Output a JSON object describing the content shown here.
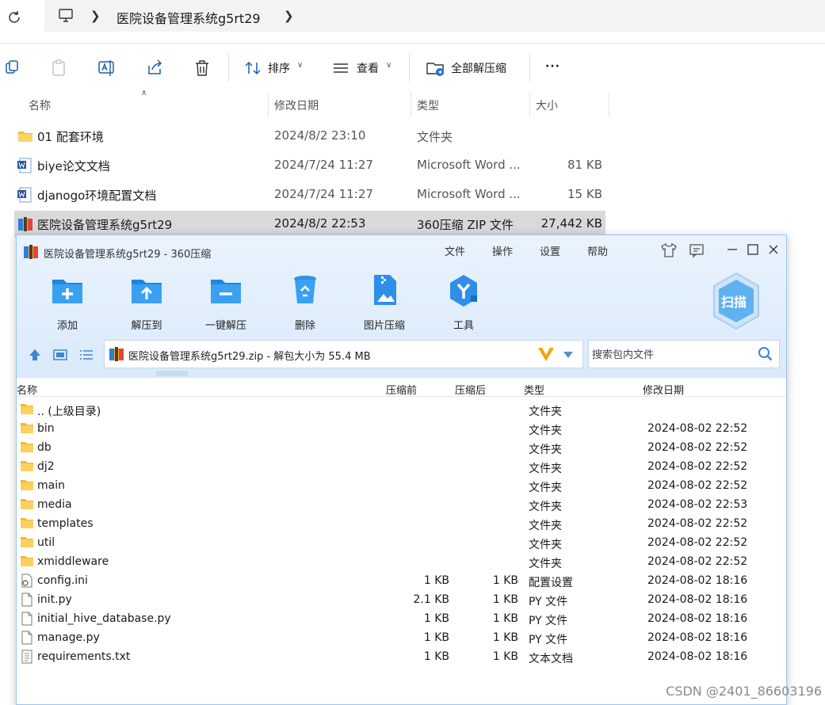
{
  "address": {
    "crumb": "医院设备管理系统g5rt29"
  },
  "toolbar": {
    "sort_label": "排序",
    "view_label": "查看",
    "extract_all_label": "全部解压缩",
    "more_label": "···"
  },
  "explorer": {
    "columns": [
      "名称",
      "修改日期",
      "类型",
      "大小"
    ],
    "rows": [
      {
        "name": "01 配套环境",
        "date": "2024/8/2 23:10",
        "type": "文件夹",
        "size": ""
      },
      {
        "name": "biye论文文档",
        "date": "2024/7/24 11:27",
        "type": "Microsoft Word ...",
        "size": "81 KB"
      },
      {
        "name": "djanogo环境配置文档",
        "date": "2024/7/24 11:27",
        "type": "Microsoft Word ...",
        "size": "15 KB"
      },
      {
        "name": "医院设备管理系统g5rt29",
        "date": "2024/8/2 22:53",
        "type": "360压缩 ZIP 文件",
        "size": "27,442 KB"
      }
    ]
  },
  "zipwin": {
    "title": "医院设备管理系统g5rt29 - 360压缩",
    "menus": [
      "文件",
      "操作",
      "设置",
      "帮助"
    ],
    "tools": [
      "添加",
      "解压到",
      "一键解压",
      "删除",
      "图片压缩",
      "工具"
    ],
    "scan_label": "扫描",
    "path_text": "医院设备管理系统g5rt29.zip - 解包大小为 55.4 MB",
    "search_placeholder": "搜索包内文件",
    "columns": [
      "名称",
      "压缩前",
      "压缩后",
      "类型",
      "修改日期"
    ],
    "rows": [
      {
        "name": ".. (上级目录)",
        "before": "",
        "after": "",
        "type": "文件夹",
        "date": ""
      },
      {
        "name": "bin",
        "before": "",
        "after": "",
        "type": "文件夹",
        "date": "2024-08-02 22:52"
      },
      {
        "name": "db",
        "before": "",
        "after": "",
        "type": "文件夹",
        "date": "2024-08-02 22:52"
      },
      {
        "name": "dj2",
        "before": "",
        "after": "",
        "type": "文件夹",
        "date": "2024-08-02 22:52"
      },
      {
        "name": "main",
        "before": "",
        "after": "",
        "type": "文件夹",
        "date": "2024-08-02 22:52"
      },
      {
        "name": "media",
        "before": "",
        "after": "",
        "type": "文件夹",
        "date": "2024-08-02 22:53"
      },
      {
        "name": "templates",
        "before": "",
        "after": "",
        "type": "文件夹",
        "date": "2024-08-02 22:52"
      },
      {
        "name": "util",
        "before": "",
        "after": "",
        "type": "文件夹",
        "date": "2024-08-02 22:52"
      },
      {
        "name": "xmiddleware",
        "before": "",
        "after": "",
        "type": "文件夹",
        "date": "2024-08-02 22:52"
      },
      {
        "name": "config.ini",
        "before": "1 KB",
        "after": "1 KB",
        "type": "配置设置",
        "date": "2024-08-02 18:16"
      },
      {
        "name": "init.py",
        "before": "2.1 KB",
        "after": "1 KB",
        "type": "PY 文件",
        "date": "2024-08-02 18:16"
      },
      {
        "name": "initial_hive_database.py",
        "before": "1 KB",
        "after": "1 KB",
        "type": "PY 文件",
        "date": "2024-08-02 18:16"
      },
      {
        "name": "manage.py",
        "before": "1 KB",
        "after": "1 KB",
        "type": "PY 文件",
        "date": "2024-08-02 18:16"
      },
      {
        "name": "requirements.txt",
        "before": "1 KB",
        "after": "1 KB",
        "type": "文本文档",
        "date": "2024-08-02 18:16"
      }
    ]
  },
  "watermark": "CSDN @2401_86603196"
}
